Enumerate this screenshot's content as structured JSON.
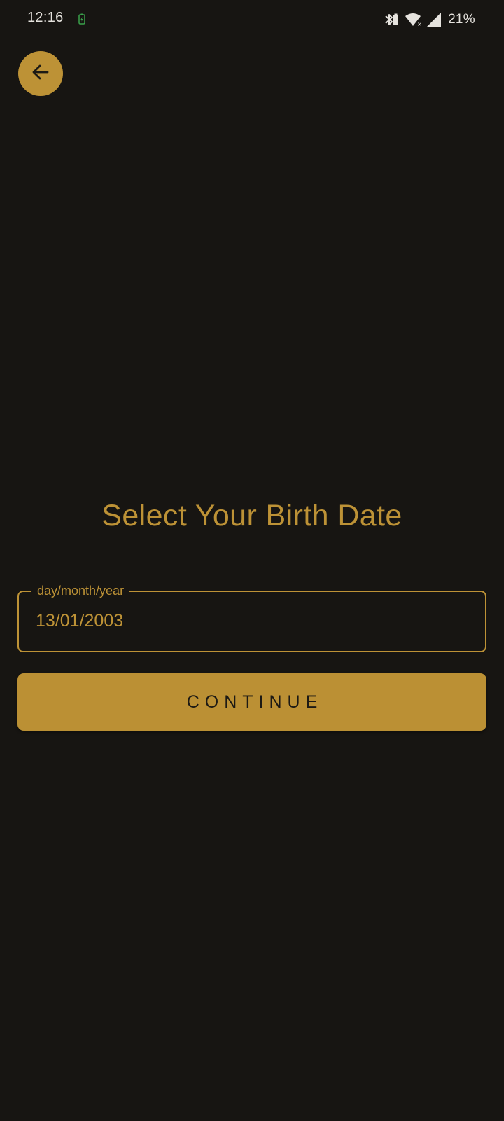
{
  "status_bar": {
    "time": "12:16",
    "battery": "21%",
    "icons": [
      "charging-indicator-icon",
      "bluetooth-icon",
      "wifi-icon",
      "cellular-signal-icon"
    ]
  },
  "header": {
    "back_icon": "arrow-left-icon"
  },
  "main": {
    "title": "Select Your Birth Date",
    "date_field": {
      "label": "day/month/year",
      "value": "13/01/2003"
    },
    "continue_label": "CONTINUE"
  },
  "colors": {
    "background": "#171512",
    "accent": "#bd9236",
    "button_text": "#1d1a14",
    "status_text": "#e6e3de"
  }
}
